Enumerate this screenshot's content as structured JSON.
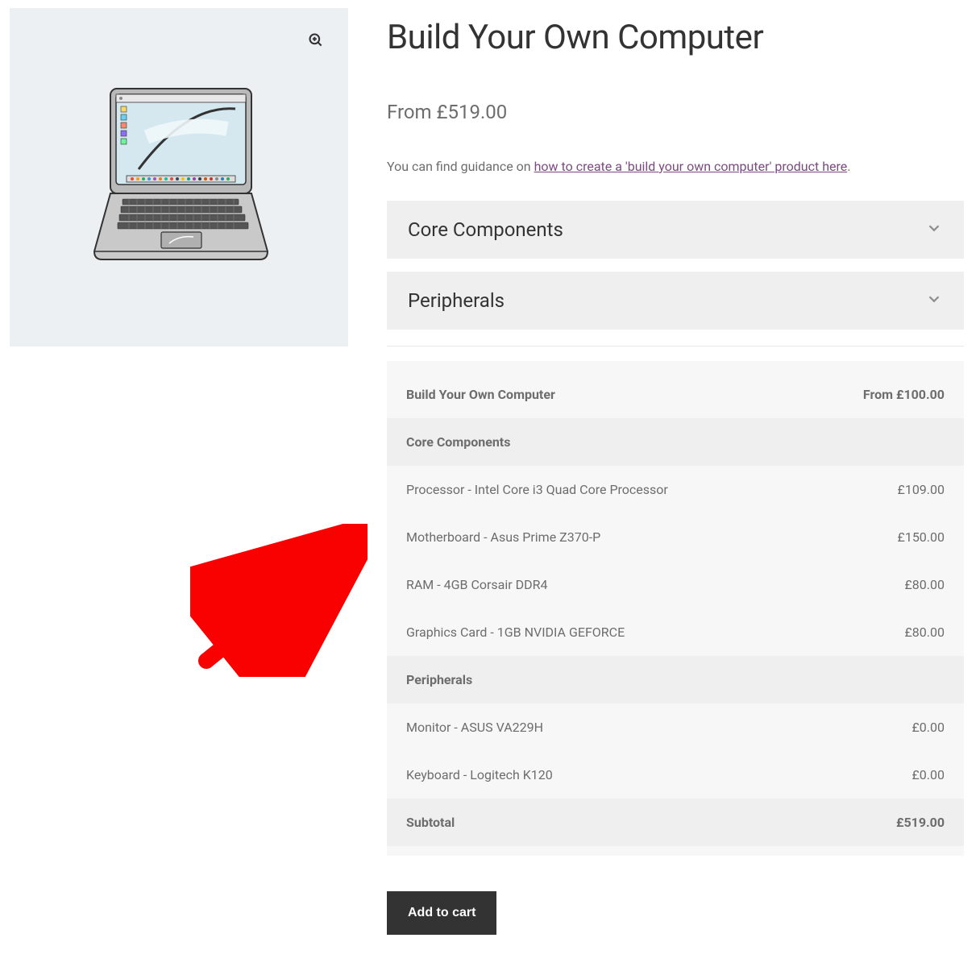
{
  "product": {
    "title": "Build Your Own Computer",
    "from_price": "From £519.00"
  },
  "guidance": {
    "prefix": "You can find guidance on ",
    "link_text": "how to create a 'build your own computer' product here",
    "suffix": "."
  },
  "accordions": [
    {
      "title": "Core Components"
    },
    {
      "title": "Peripherals"
    }
  ],
  "summary": {
    "header": {
      "label": "Build Your Own Computer",
      "value": "From £100.00"
    },
    "sections": [
      {
        "heading": "Core Components",
        "lines": [
          {
            "label": "Processor - Intel Core i3 Quad Core Processor",
            "value": "£109.00"
          },
          {
            "label": "Motherboard - Asus Prime Z370-P",
            "value": "£150.00"
          },
          {
            "label": "RAM - 4GB Corsair DDR4",
            "value": "£80.00"
          },
          {
            "label": "Graphics Card - 1GB NVIDIA GEFORCE",
            "value": "£80.00"
          }
        ]
      },
      {
        "heading": "Peripherals",
        "lines": [
          {
            "label": "Monitor - ASUS VA229H",
            "value": "£0.00"
          },
          {
            "label": "Keyboard - Logitech K120",
            "value": "£0.00"
          }
        ]
      }
    ],
    "subtotal": {
      "label": "Subtotal",
      "value": "£519.00"
    }
  },
  "actions": {
    "add_to_cart": "Add to cart"
  }
}
